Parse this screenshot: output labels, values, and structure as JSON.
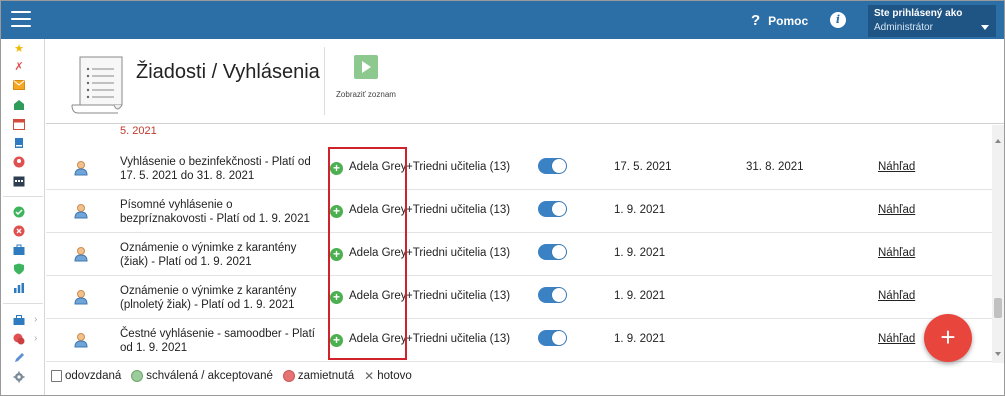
{
  "topbar": {
    "help_label": "Pomoc",
    "help_icon": "?",
    "info_icon": "i",
    "user_label": "Ste prihlásený ako",
    "user_role": "Administrátor"
  },
  "header": {
    "title": "Žiadosti / Vyhlásenia",
    "show_list_label": "Zobraziť zoznam"
  },
  "table": {
    "partial_row_text": "5. 2021",
    "rows": [
      {
        "doc": "Vyhlásenie o bezinfekčnosti - Platí od 17. 5. 2021 do 31. 8. 2021",
        "user": "Adela Grey",
        "group": "+Triedni učitelia (13)",
        "date_from": "17. 5. 2021",
        "date_to": "31. 8. 2021",
        "preview": "Náhľad"
      },
      {
        "doc": "Písomné vyhlásenie o bezpríznakovosti - Platí od 1. 9. 2021",
        "user": "Adela Grey",
        "group": "+Triedni učitelia (13)",
        "date_from": "1. 9. 2021",
        "date_to": "",
        "preview": "Náhľad"
      },
      {
        "doc": "Oznámenie o výnimke z karantény (žiak) - Platí od 1. 9. 2021",
        "user": "Adela Grey",
        "group": "+Triedni učitelia (13)",
        "date_from": "1. 9. 2021",
        "date_to": "",
        "preview": "Náhľad"
      },
      {
        "doc": "Oznámenie o výnimke z karantény (plnoletý žiak) - Platí od 1. 9. 2021",
        "user": "Adela Grey",
        "group": "+Triedni učitelia (13)",
        "date_from": "1. 9. 2021",
        "date_to": "",
        "preview": "Náhľad"
      },
      {
        "doc": "Čestné vyhlásenie - samoodber - Platí od 1. 9. 2021",
        "user": "Adela Grey",
        "group": "+Triedni učitelia (13)",
        "date_from": "1. 9. 2021",
        "date_to": "",
        "preview": "Náhľad"
      }
    ]
  },
  "legend": {
    "sent": "odovzdaná",
    "approved": "schválená / akceptované",
    "rejected": "zamietnutá",
    "done": "hotovo"
  },
  "fab_label": "+",
  "colors": {
    "topbar": "#2c6ea6",
    "accent_toggle": "#3b82c4",
    "fab": "#e8453c",
    "highlight": "#d0222b",
    "add_green": "#4caf50"
  }
}
